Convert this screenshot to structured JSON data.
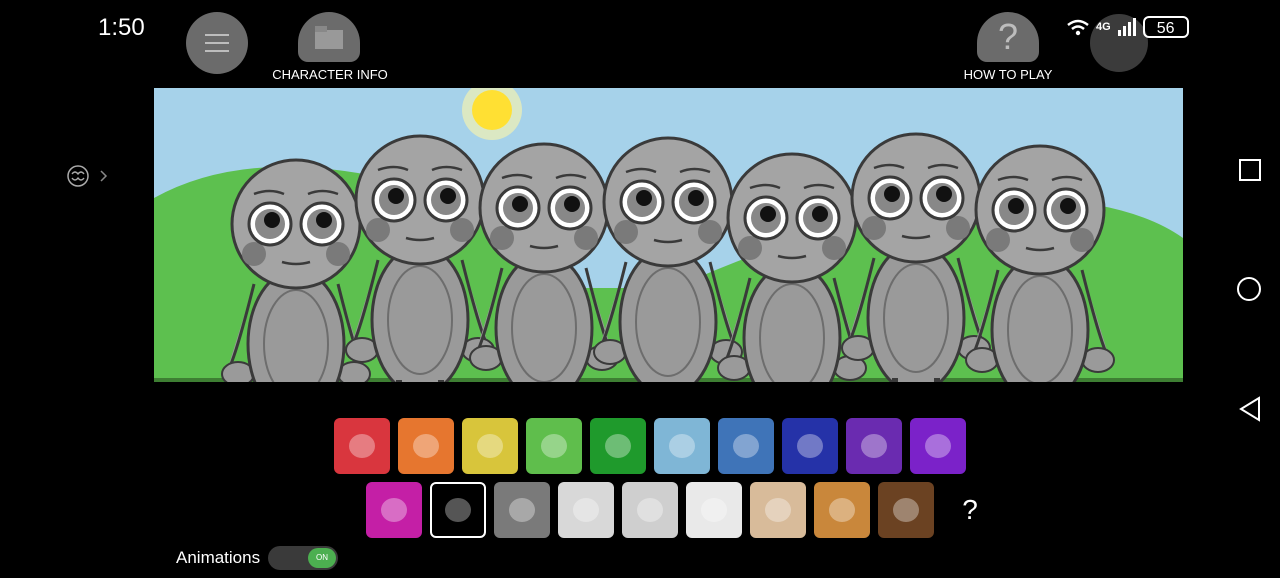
{
  "status_bar": {
    "time": "1:50",
    "network": "4G",
    "battery": "56",
    "icons": [
      "wifi-icon",
      "signal-icon",
      "battery-icon"
    ]
  },
  "toolbar": {
    "menu_icon": "menu-icon",
    "character_info_label": "CHARACTER INFO",
    "help_icon": "question-icon",
    "how_to_play_label": "HOW TO PLAY"
  },
  "side": {
    "icon": "brain-icon",
    "chevron": "chevron-right-icon"
  },
  "stage": {
    "sky_color": "#a6d2ea",
    "grass_color": "#5dc04f",
    "character_count": 7
  },
  "palette": {
    "row1": [
      {
        "name": "red-apple",
        "color": "#d9363e"
      },
      {
        "name": "orange-paw",
        "color": "#e6762f"
      },
      {
        "name": "yellow-honeycomb",
        "color": "#d8c53b"
      },
      {
        "name": "green-hat",
        "color": "#5fbe4c"
      },
      {
        "name": "green-hand",
        "color": "#1f9a2c"
      },
      {
        "name": "lightblue-fan",
        "color": "#7fb6d6"
      },
      {
        "name": "blue-leaf",
        "color": "#3f74b8"
      },
      {
        "name": "darkblue-flame",
        "color": "#2532a8"
      },
      {
        "name": "purple-swirl",
        "color": "#6a2bb0"
      },
      {
        "name": "violet-feather",
        "color": "#7b22c9"
      }
    ],
    "row2": [
      {
        "name": "magenta-card",
        "color": "#c41fa6"
      },
      {
        "name": "black-crystal",
        "color": "#000000"
      },
      {
        "name": "gray-paw",
        "color": "#7a7a7a"
      },
      {
        "name": "white-shell",
        "color": "#d8d8d8"
      },
      {
        "name": "fern-leaf",
        "color": "#cfcfcf"
      },
      {
        "name": "rainbow-flower",
        "color": "#e9e9e9"
      },
      {
        "name": "beige-horn",
        "color": "#d8bb9a"
      },
      {
        "name": "tan-bread",
        "color": "#c9873b"
      },
      {
        "name": "brown-paw",
        "color": "#6b4222"
      },
      {
        "name": "mystery",
        "label": "?",
        "color": "#000000"
      }
    ]
  },
  "animations": {
    "label": "Animations",
    "toggle": "ON"
  }
}
